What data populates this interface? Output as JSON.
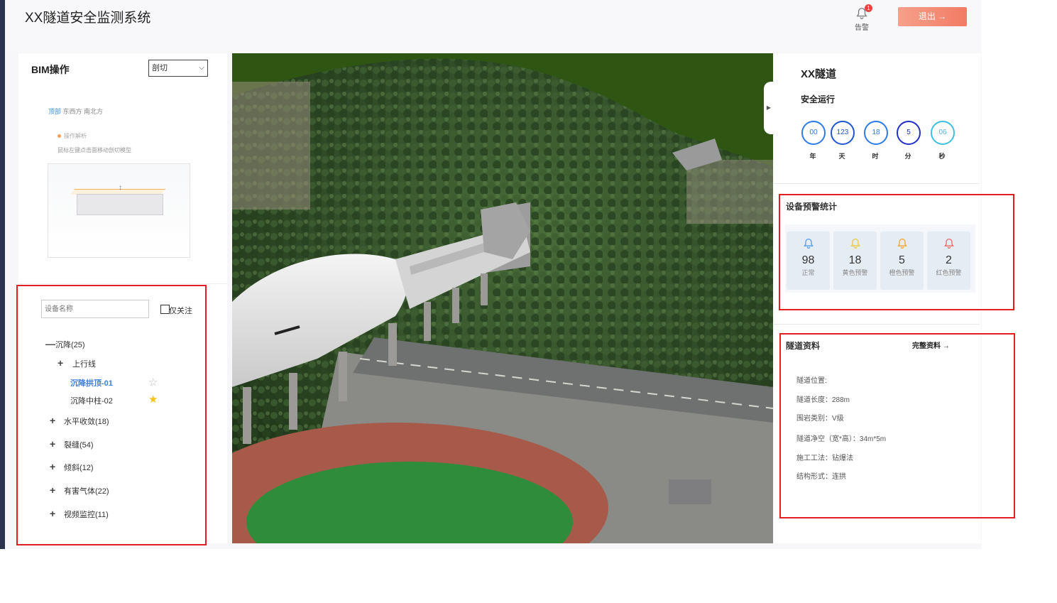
{
  "app": {
    "title": "XX隧道安全监测系统"
  },
  "header": {
    "alarm_count": "1",
    "alarm_label": "告警",
    "logout_label": "退出",
    "logout_arrow": "→"
  },
  "bim": {
    "title": "BIM操作",
    "mode": "剖切",
    "views": {
      "top": "顶部",
      "rest": "东西方 南北方"
    },
    "hint_title": "操作解析",
    "hint_text": "鼠标左键点击面移动剖切模型"
  },
  "device_tree": {
    "search_placeholder": "设备名称",
    "follow_only_label": "仅关注",
    "items": [
      {
        "sign": "—",
        "label": "沉降(25)"
      },
      {
        "sign": "+",
        "label": "上行线"
      },
      {
        "sign": "",
        "label": "沉降拱顶-01",
        "selected": true,
        "star": "☆",
        "star_color": "#bbbbbb"
      },
      {
        "sign": "",
        "label": "沉降中柱-02",
        "star": "★",
        "star_color": "#f5c518"
      },
      {
        "sign": "+",
        "label": "水平收敛(18)"
      },
      {
        "sign": "+",
        "label": "裂缝(54)"
      },
      {
        "sign": "+",
        "label": "倾斜(12)"
      },
      {
        "sign": "+",
        "label": "有害气体(22)"
      },
      {
        "sign": "+",
        "label": "视频监控(11)"
      }
    ]
  },
  "tunnel": {
    "name": "XX隧道",
    "status": "安全运行",
    "runtime": [
      {
        "value": "00",
        "unit": "年",
        "color": "#2d7be8"
      },
      {
        "value": "123",
        "unit": "天",
        "color": "#1f56d0"
      },
      {
        "value": "18",
        "unit": "时",
        "color": "#2d7be8"
      },
      {
        "value": "5",
        "unit": "分",
        "color": "#2030c8"
      },
      {
        "value": "06",
        "unit": "秒",
        "color": "#3fc0e0"
      }
    ]
  },
  "warnings": {
    "title": "设备预警统计",
    "items": [
      {
        "value": "98",
        "label": "正常",
        "color": "#4a9cf0"
      },
      {
        "value": "18",
        "label": "黄色预警",
        "color": "#e8c73a"
      },
      {
        "value": "5",
        "label": "橙色预警",
        "color": "#f0a030"
      },
      {
        "value": "2",
        "label": "红色预警",
        "color": "#f06060"
      }
    ]
  },
  "tunnel_info": {
    "title": "隧道资料",
    "more_label": "完整资料 →",
    "rows": [
      "隧道位置:",
      "隧道长度：288m",
      "围岩类别：V级",
      "隧道净空（宽*高）：34m*5m",
      "施工工法：钻爆法",
      "结构形式：连拱"
    ]
  }
}
